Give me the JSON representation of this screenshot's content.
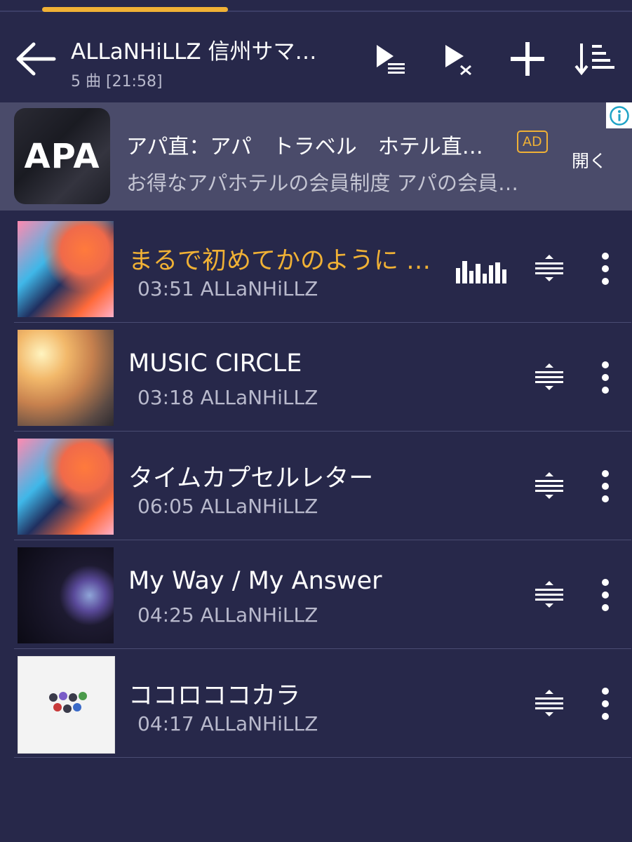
{
  "colors": {
    "background": "#27284a",
    "accent": "#f0b135",
    "ad_background": "#4a4b6a",
    "secondary_text": "#b8b9cc"
  },
  "header": {
    "title": "ALLaNHiLLZ 信州サマ…",
    "subtitle": "5 曲 [21:58]",
    "icons": [
      "back-arrow-icon",
      "play-queue-icon",
      "shuffle-play-icon",
      "add-icon",
      "sort-icon"
    ]
  },
  "ad": {
    "logo_text": "APA",
    "title": "アパ直：アパ　トラベル　ホテル直…",
    "badge": "AD",
    "description": "お得なアパホテルの会員制度 アパの会員…",
    "open_label": "開く",
    "info_icon": "info-icon"
  },
  "tracks": [
    {
      "title": "まるで初めてかのように …",
      "meta": "03:51 ALLaNHiLLZ",
      "playing": true
    },
    {
      "title": "MUSIC CIRCLE",
      "meta": "03:18 ALLaNHiLLZ",
      "playing": false
    },
    {
      "title": "タイムカプセルレター",
      "meta": "06:05 ALLaNHiLLZ",
      "playing": false
    },
    {
      "title": "My Way / My Answer",
      "meta": "04:25 ALLaNHiLLZ",
      "playing": false
    },
    {
      "title": "ココロココカラ",
      "meta": "04:17 ALLaNHiLLZ",
      "playing": false
    }
  ]
}
